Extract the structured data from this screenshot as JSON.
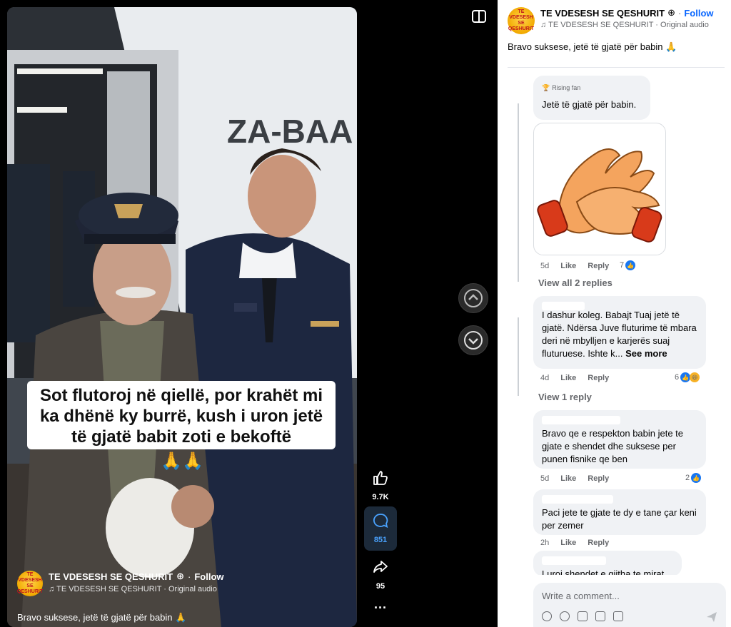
{
  "video": {
    "caption": "Sot flutoroj në qiellë, por krahët mi ka dhënë ky burrë, kush i uron jetë të gjatë babit zoti e bekoftë",
    "caption_emoji": "🙏🙏",
    "aircraft_reg": "ZA-BAA",
    "author": "TE VDESESH SE QESHURIT",
    "author_avatar_text": "TE VDESESH SE QESHURIT",
    "follow": "Follow",
    "audio": "♫ TE VDESESH SE QESHURIT · Original audio",
    "description": "Bravo suksese, jetë të gjatë për babin 🙏"
  },
  "actions": {
    "likes": "9.7K",
    "comments": "851",
    "shares": "95",
    "more": "···"
  },
  "panel": {
    "author": "TE VDESESH SE QESHURIT",
    "follow": "Follow",
    "audio": "♫ TE VDESESH SE QESHURIT · Original audio",
    "description": "Bravo suksese, jetë të gjatë për babin 🙏"
  },
  "comments": [
    {
      "badge": "Rising fan",
      "text": "Jetë të gjatë për babin.",
      "time": "5d",
      "like": "Like",
      "reply": "Reply",
      "reactions": "7",
      "view_replies": "View all 2 replies"
    },
    {
      "text": "I dashur koleg. Babajt Tuaj jetë të gjatë. Ndërsa Juve fluturime të mbara deri në mbylljen e karjerës suaj fluturuese. Ishte k...",
      "see_more": "See more",
      "time": "4d",
      "like": "Like",
      "reply": "Reply",
      "reactions": "6",
      "view_replies": "View 1 reply"
    },
    {
      "text": "Bravo qe e respekton babin jete te gjate e shendet dhe suksese per punen fisnike qe ben",
      "time": "5d",
      "like": "Like",
      "reply": "Reply",
      "reactions": "2"
    },
    {
      "text": "Paci jete te gjate te dy e tane çar keni per zemer",
      "time": "2h",
      "like": "Like",
      "reply": "Reply"
    },
    {
      "text": "Luroi shendet e gjitha te mirat"
    }
  ],
  "composer": {
    "placeholder": "Write a comment..."
  }
}
